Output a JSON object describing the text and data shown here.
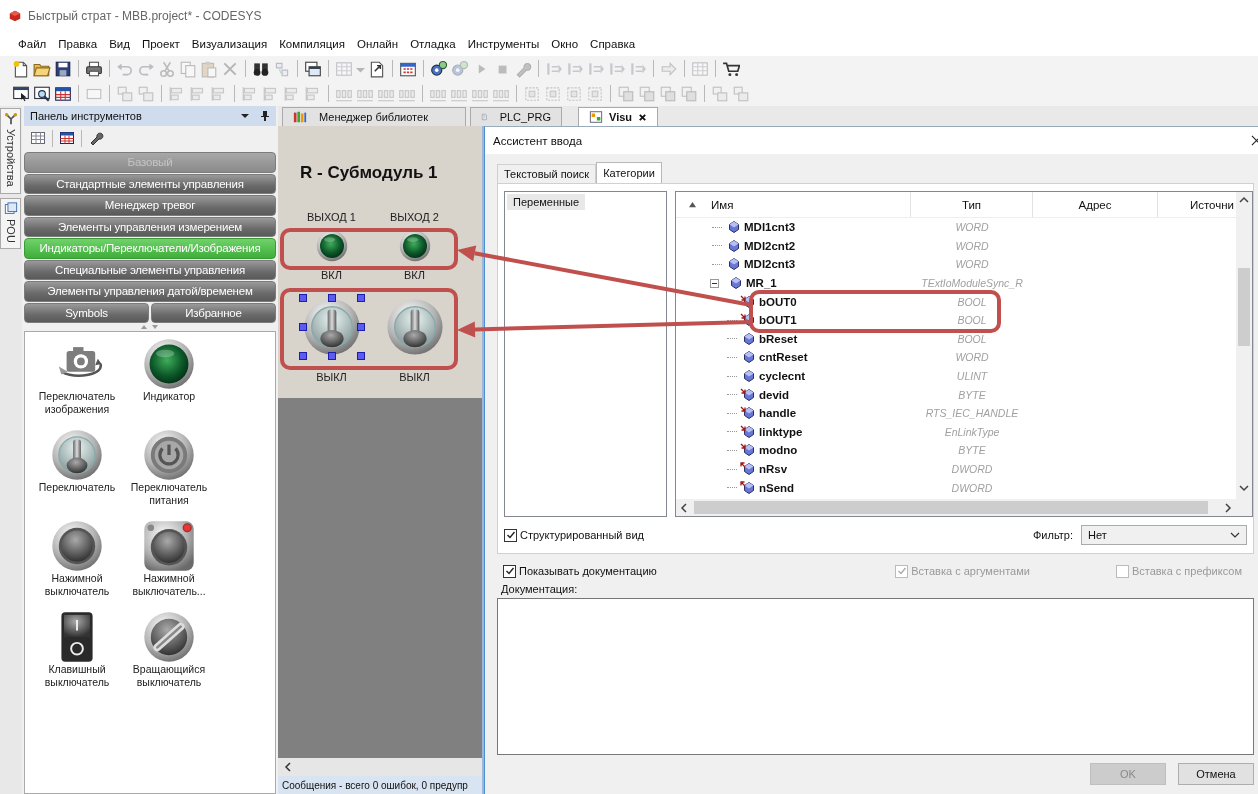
{
  "window": {
    "title": "Быстрый страт - MBB.project* - CODESYS"
  },
  "menu": [
    "Файл",
    "Правка",
    "Вид",
    "Проект",
    "Визуализация",
    "Компиляция",
    "Онлайн",
    "Отладка",
    "Инструменты",
    "Окно",
    "Справка"
  ],
  "toolbars": [
    [
      {
        "kind": "doc",
        "disabled": false
      },
      {
        "kind": "folder",
        "disabled": false
      },
      {
        "kind": "save",
        "disabled": false
      },
      {
        "kind": "sep"
      },
      {
        "kind": "print",
        "disabled": false
      },
      {
        "kind": "sep"
      },
      {
        "kind": "undo",
        "disabled": true
      },
      {
        "kind": "redo",
        "disabled": true
      },
      {
        "kind": "cut",
        "disabled": true
      },
      {
        "kind": "copy",
        "disabled": true
      },
      {
        "kind": "paste",
        "disabled": true
      },
      {
        "kind": "delete",
        "disabled": true
      },
      {
        "kind": "sep"
      },
      {
        "kind": "find",
        "disabled": false
      },
      {
        "kind": "replace",
        "disabled": true
      },
      {
        "kind": "sep"
      },
      {
        "kind": "window",
        "disabled": false
      },
      {
        "kind": "sep"
      },
      {
        "kind": "grid",
        "disabled": true
      },
      {
        "kind": "caret",
        "disabled": true
      },
      {
        "kind": "export",
        "disabled": false
      },
      {
        "kind": "sep"
      },
      {
        "kind": "calendar",
        "disabled": false
      },
      {
        "kind": "sep"
      },
      {
        "kind": "gears",
        "disabled": false
      },
      {
        "kind": "gears",
        "disabled": true
      },
      {
        "kind": "play",
        "disabled": true
      },
      {
        "kind": "stop",
        "disabled": true
      },
      {
        "kind": "wrench",
        "disabled": true
      },
      {
        "kind": "sep"
      },
      {
        "kind": "step",
        "disabled": true
      },
      {
        "kind": "step",
        "disabled": true
      },
      {
        "kind": "step",
        "disabled": true
      },
      {
        "kind": "step",
        "disabled": true
      },
      {
        "kind": "step",
        "disabled": true
      },
      {
        "kind": "sep"
      },
      {
        "kind": "arrow",
        "disabled": true
      },
      {
        "kind": "sep"
      },
      {
        "kind": "grid",
        "disabled": true
      },
      {
        "kind": "sep"
      },
      {
        "kind": "cart",
        "disabled": false
      }
    ],
    [
      {
        "kind": "select",
        "disabled": false
      },
      {
        "kind": "zoom",
        "disabled": false
      },
      {
        "kind": "table",
        "disabled": false
      },
      {
        "kind": "sep"
      },
      {
        "kind": "rect",
        "disabled": true
      },
      {
        "kind": "sep"
      },
      {
        "kind": "group",
        "disabled": true
      },
      {
        "kind": "group",
        "disabled": true
      },
      {
        "kind": "sep"
      },
      {
        "kind": "align",
        "disabled": true
      },
      {
        "kind": "align",
        "disabled": true
      },
      {
        "kind": "align",
        "disabled": true
      },
      {
        "kind": "sep"
      },
      {
        "kind": "align",
        "disabled": true
      },
      {
        "kind": "align",
        "disabled": true
      },
      {
        "kind": "align",
        "disabled": true
      },
      {
        "kind": "align",
        "disabled": true
      },
      {
        "kind": "sep"
      },
      {
        "kind": "distribute",
        "disabled": true
      },
      {
        "kind": "distribute",
        "disabled": true
      },
      {
        "kind": "distribute",
        "disabled": true
      },
      {
        "kind": "distribute",
        "disabled": true
      },
      {
        "kind": "sep"
      },
      {
        "kind": "distribute",
        "disabled": true
      },
      {
        "kind": "distribute",
        "disabled": true
      },
      {
        "kind": "distribute",
        "disabled": true
      },
      {
        "kind": "distribute",
        "disabled": true
      },
      {
        "kind": "sep"
      },
      {
        "kind": "frame",
        "disabled": true
      },
      {
        "kind": "frame",
        "disabled": true
      },
      {
        "kind": "frame",
        "disabled": true
      },
      {
        "kind": "frame",
        "disabled": true
      },
      {
        "kind": "sep"
      },
      {
        "kind": "order",
        "disabled": true
      },
      {
        "kind": "order",
        "disabled": true
      },
      {
        "kind": "order",
        "disabled": true
      },
      {
        "kind": "order",
        "disabled": true
      },
      {
        "kind": "sep"
      },
      {
        "kind": "group",
        "disabled": true
      },
      {
        "kind": "group",
        "disabled": true
      }
    ]
  ],
  "side_tabs": [
    {
      "label": "Устройства",
      "kind": "devices"
    },
    {
      "label": "POU",
      "kind": "pou"
    }
  ],
  "toolbox": {
    "title": "Панель инструментов",
    "categories": [
      {
        "label": "Базовый",
        "disabled": true,
        "selected": false
      },
      {
        "label": "Стандартные элементы управления",
        "disabled": false,
        "selected": false
      },
      {
        "label": "Менеджер тревог",
        "disabled": false,
        "selected": false
      },
      {
        "label": "Элементы управления измерением",
        "disabled": false,
        "selected": false
      },
      {
        "label": "Индикаторы/Переключатели/Изображения",
        "disabled": false,
        "selected": true
      },
      {
        "label": "Специальные элементы управления",
        "disabled": false,
        "selected": false
      },
      {
        "label": "Элементы управления датой/временем",
        "disabled": false,
        "selected": false
      }
    ],
    "bottom_tabs": [
      {
        "label": "Symbols",
        "selected": false
      },
      {
        "label": "Избранное",
        "selected": false
      }
    ],
    "items": [
      {
        "kind": "image-switch",
        "label": "Переключатель изображения"
      },
      {
        "kind": "lamp",
        "label": "Индикатор"
      },
      {
        "kind": "toggle",
        "label": "Переключатель"
      },
      {
        "kind": "power",
        "label": "Переключатель питания"
      },
      {
        "kind": "push",
        "label": "Нажимной выключатель"
      },
      {
        "kind": "push-led",
        "label": "Нажимной выключатель..."
      },
      {
        "kind": "rocker",
        "label": "Клавишный выключатель"
      },
      {
        "kind": "rotary",
        "label": "Вращающийся выключатель"
      }
    ]
  },
  "editor_tabs": [
    {
      "label": "Менеджер библиотек",
      "kind": "library",
      "selected": false,
      "closable": false
    },
    {
      "label": "PLC_PRG",
      "kind": "program",
      "selected": false,
      "closable": false
    },
    {
      "label": "Visu",
      "kind": "visualization",
      "selected": true,
      "closable": true
    }
  ],
  "canvas": {
    "title": "R - Субмодуль 1",
    "lamps": [
      {
        "caption": "ВЫХОД 1",
        "state_label": "ВКЛ"
      },
      {
        "caption": "ВЫХОД 2",
        "state_label": "ВКЛ"
      }
    ],
    "switches": [
      {
        "label": "ВЫКЛ",
        "selected": true
      },
      {
        "label": "ВЫКЛ",
        "selected": false
      }
    ]
  },
  "status": "Сообщения - всего 0 ошибок, 0 предупр",
  "dialog": {
    "title": "Ассистент ввода",
    "tabs": [
      {
        "label": "Текстовый поиск",
        "selected": false
      },
      {
        "label": "Категории",
        "selected": true
      }
    ],
    "categories": [
      {
        "label": "Переменные",
        "selected": true
      }
    ],
    "columns": [
      "Имя",
      "Тип",
      "Адрес",
      "Источни"
    ],
    "rows": [
      {
        "name": "MDI1cnt3",
        "type": "WORD",
        "kind": "var"
      },
      {
        "name": "MDI2cnt2",
        "type": "WORD",
        "kind": "var"
      },
      {
        "name": "MDI2cnt3",
        "type": "WORD",
        "kind": "var"
      },
      {
        "name": "MR_1",
        "type": "TExtIoModuleSync_R",
        "kind": "var",
        "expanded": true,
        "children": [
          {
            "name": "bOUT0",
            "type": "BOOL",
            "kind": "input"
          },
          {
            "name": "bOUT1",
            "type": "BOOL",
            "kind": "input"
          },
          {
            "name": "bReset",
            "type": "BOOL",
            "kind": "var"
          },
          {
            "name": "cntReset",
            "type": "WORD",
            "kind": "var"
          },
          {
            "name": "cyclecnt",
            "type": "ULINT",
            "kind": "var"
          },
          {
            "name": "devid",
            "type": "BYTE",
            "kind": "input"
          },
          {
            "name": "handle",
            "type": "RTS_IEC_HANDLE",
            "kind": "input"
          },
          {
            "name": "linktype",
            "type": "EnLinkType",
            "kind": "input"
          },
          {
            "name": "modno",
            "type": "BYTE",
            "kind": "input"
          },
          {
            "name": "nRsv",
            "type": "DWORD",
            "kind": "output"
          },
          {
            "name": "nSend",
            "type": "DWORD",
            "kind": "output"
          }
        ]
      }
    ],
    "structured_view": {
      "label": "Структурированный вид",
      "checked": true
    },
    "filter": {
      "label": "Фильтр:",
      "value": "Нет"
    },
    "options": [
      {
        "label": "Показывать документацию",
        "checked": true,
        "disabled": false
      },
      {
        "label": "Вставка с аргументами",
        "checked": true,
        "disabled": true
      },
      {
        "label": "Вставка с префиксом",
        "checked": false,
        "disabled": true
      }
    ],
    "doc_label": "Документация:",
    "buttons": [
      {
        "label": "OK",
        "disabled": true
      },
      {
        "label": "Отмена",
        "disabled": false
      }
    ]
  }
}
